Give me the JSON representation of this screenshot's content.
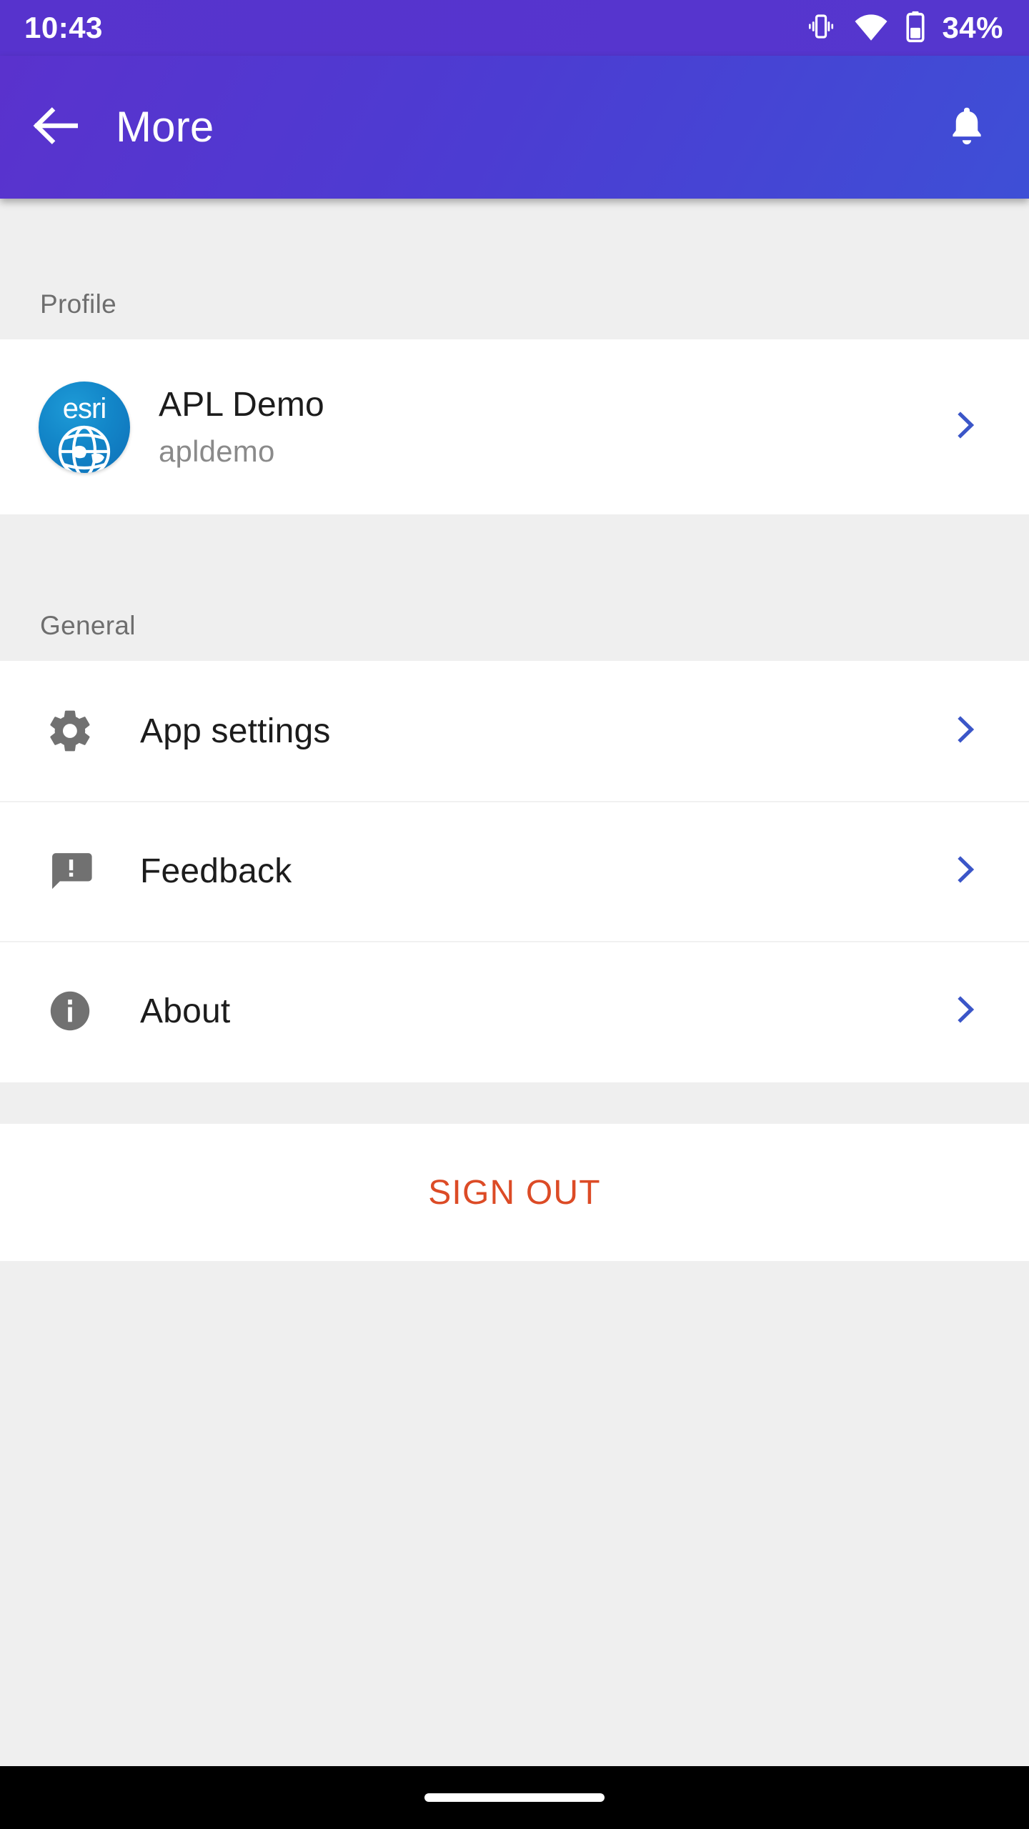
{
  "status_bar": {
    "time": "10:43",
    "battery_percent": "34%",
    "icons": [
      "vibrate-icon",
      "wifi-icon",
      "battery-icon"
    ]
  },
  "app_bar": {
    "title": "More",
    "back_icon": "arrow-left-icon",
    "notification_icon": "bell-icon",
    "gradient_start": "#5A32CD",
    "gradient_end": "#3E4FD6"
  },
  "sections": [
    {
      "id": "profile",
      "header": "Profile"
    },
    {
      "id": "general",
      "header": "General"
    }
  ],
  "profile": {
    "avatar_text": "esri",
    "name": "APL Demo",
    "username": "apldemo",
    "chevron_icon": "chevron-right-icon"
  },
  "general_items": [
    {
      "label": "App settings",
      "icon": "gear-icon",
      "chevron_icon": "chevron-right-icon"
    },
    {
      "label": "Feedback",
      "icon": "feedback-bubble-icon",
      "chevron_icon": "chevron-right-icon"
    },
    {
      "label": "About",
      "icon": "info-circle-icon",
      "chevron_icon": "chevron-right-icon"
    }
  ],
  "sign_out": {
    "label": "SIGN OUT",
    "color": "#DC4B26"
  },
  "colors": {
    "page_background": "#EFEFEF",
    "surface": "#FFFFFF",
    "chevron_blue": "#3B56C8",
    "section_header_text": "#6E6E6E",
    "primary_text": "#1C1C1C",
    "secondary_text": "#8A8A8A",
    "nav_bar": "#000000"
  },
  "nav_bar": {
    "handle": "home-gesture-pill"
  }
}
